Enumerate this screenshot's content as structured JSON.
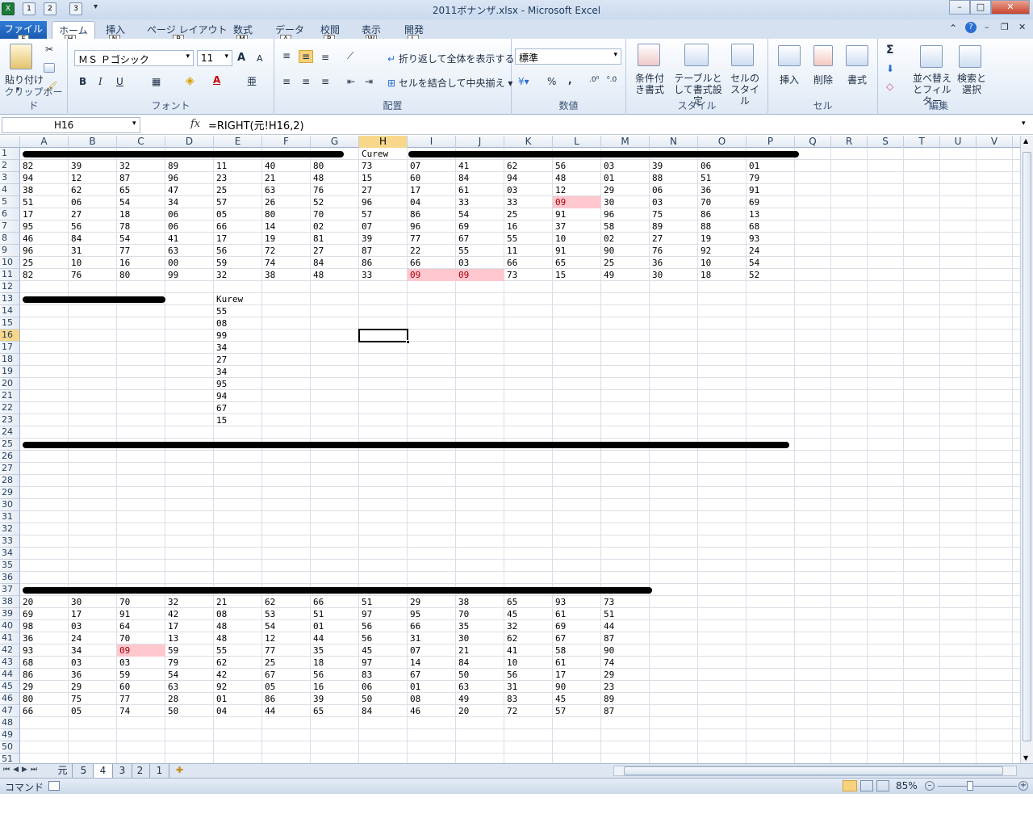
{
  "window": {
    "title": "2011ボナンザ.xlsx - Microsoft Excel"
  },
  "qat": {
    "keys": [
      "1",
      "2",
      "3"
    ]
  },
  "tabs": [
    {
      "label": "ファイル",
      "key": "F"
    },
    {
      "label": "ホーム",
      "key": "H"
    },
    {
      "label": "挿入",
      "key": "N"
    },
    {
      "label": "ページ レイアウト",
      "key": "P"
    },
    {
      "label": "数式",
      "key": "M"
    },
    {
      "label": "データ",
      "key": "A"
    },
    {
      "label": "校閲",
      "key": "R"
    },
    {
      "label": "表示",
      "key": "W"
    },
    {
      "label": "開発",
      "key": "L"
    }
  ],
  "ribbon": {
    "clipboard": {
      "paste": "貼り付け",
      "group": "クリップボード"
    },
    "font": {
      "name": "ＭＳ Ｐゴシック",
      "size": "11",
      "group": "フォント",
      "bold": "B",
      "italic": "I",
      "underline": "U",
      "grow": "A",
      "shrink": "A"
    },
    "alignment": {
      "wrap": "折り返して全体を表示する",
      "merge": "セルを結合して中央揃え",
      "group": "配置"
    },
    "number": {
      "format": "標準",
      "percent": "%",
      "comma": ",",
      "group": "数値"
    },
    "styles": {
      "conditional": "条件付き書式",
      "table": "テーブルとして書式設定",
      "cell_styles": "セルのスタイル",
      "group": "スタイル"
    },
    "cells": {
      "insert": "挿入",
      "delete": "削除",
      "format": "書式",
      "group": "セル"
    },
    "editing": {
      "sort": "並べ替えとフィルター",
      "find": "検索と選択",
      "group": "編集",
      "sum": "Σ"
    }
  },
  "formula_bar": {
    "name_box": "H16",
    "fx": "fx",
    "formula": "=RIGHT(元!H16,2)"
  },
  "columns": [
    "A",
    "B",
    "C",
    "D",
    "E",
    "F",
    "G",
    "H",
    "I",
    "J",
    "K",
    "L",
    "M",
    "N",
    "O",
    "P",
    "Q",
    "R",
    "S",
    "T",
    "U",
    "V"
  ],
  "selected_cell": {
    "col": "H",
    "row": 16
  },
  "sheet": {
    "row1_labels": {
      "H": "Curew"
    },
    "block1": [
      [
        "82",
        "39",
        "32",
        "89",
        "11",
        "40",
        "80",
        "73",
        "07",
        "41",
        "62",
        "56",
        "03",
        "39",
        "06",
        "01"
      ],
      [
        "94",
        "12",
        "87",
        "96",
        "23",
        "21",
        "48",
        "15",
        "60",
        "84",
        "94",
        "48",
        "01",
        "88",
        "51",
        "79"
      ],
      [
        "38",
        "62",
        "65",
        "47",
        "25",
        "63",
        "76",
        "27",
        "17",
        "61",
        "03",
        "12",
        "29",
        "06",
        "36",
        "91"
      ],
      [
        "51",
        "06",
        "54",
        "34",
        "57",
        "26",
        "52",
        "96",
        "04",
        "33",
        "33",
        "09",
        "30",
        "03",
        "70",
        "69"
      ],
      [
        "17",
        "27",
        "18",
        "06",
        "05",
        "80",
        "70",
        "57",
        "86",
        "54",
        "25",
        "91",
        "96",
        "75",
        "86",
        "13"
      ],
      [
        "95",
        "56",
        "78",
        "06",
        "66",
        "14",
        "02",
        "07",
        "96",
        "69",
        "16",
        "37",
        "58",
        "89",
        "88",
        "68"
      ],
      [
        "46",
        "84",
        "54",
        "41",
        "17",
        "19",
        "81",
        "39",
        "77",
        "67",
        "55",
        "10",
        "02",
        "27",
        "19",
        "93"
      ],
      [
        "96",
        "31",
        "77",
        "63",
        "56",
        "72",
        "27",
        "87",
        "22",
        "55",
        "11",
        "91",
        "90",
        "76",
        "92",
        "24"
      ],
      [
        "25",
        "10",
        "16",
        "00",
        "59",
        "74",
        "84",
        "86",
        "66",
        "03",
        "66",
        "65",
        "25",
        "36",
        "10",
        "54"
      ],
      [
        "82",
        "76",
        "80",
        "99",
        "32",
        "38",
        "48",
        "33",
        "09",
        "09",
        "73",
        "15",
        "49",
        "30",
        "18",
        "52"
      ]
    ],
    "block2_label": "Kurew",
    "block2": [
      "55",
      "08",
      "99",
      "34",
      "27",
      "34",
      "95",
      "94",
      "67",
      "15"
    ],
    "block3": [
      [
        "20",
        "30",
        "70",
        "32",
        "21",
        "62",
        "66",
        "51",
        "29",
        "38",
        "65",
        "93",
        "73"
      ],
      [
        "69",
        "17",
        "91",
        "42",
        "08",
        "53",
        "51",
        "97",
        "95",
        "70",
        "45",
        "61",
        "51"
      ],
      [
        "98",
        "03",
        "64",
        "17",
        "48",
        "54",
        "01",
        "56",
        "66",
        "35",
        "32",
        "69",
        "44"
      ],
      [
        "36",
        "24",
        "70",
        "13",
        "48",
        "12",
        "44",
        "56",
        "31",
        "30",
        "62",
        "67",
        "87"
      ],
      [
        "93",
        "34",
        "09",
        "59",
        "55",
        "77",
        "35",
        "45",
        "07",
        "21",
        "41",
        "58",
        "90"
      ],
      [
        "68",
        "03",
        "03",
        "79",
        "62",
        "25",
        "18",
        "97",
        "14",
        "84",
        "10",
        "61",
        "74"
      ],
      [
        "86",
        "36",
        "59",
        "54",
        "42",
        "67",
        "56",
        "83",
        "67",
        "50",
        "56",
        "17",
        "29"
      ],
      [
        "29",
        "29",
        "60",
        "63",
        "92",
        "05",
        "16",
        "06",
        "01",
        "63",
        "31",
        "90",
        "23"
      ],
      [
        "80",
        "75",
        "77",
        "28",
        "01",
        "86",
        "39",
        "50",
        "08",
        "49",
        "83",
        "45",
        "89"
      ],
      [
        "66",
        "05",
        "74",
        "50",
        "04",
        "44",
        "65",
        "84",
        "46",
        "20",
        "72",
        "57",
        "87"
      ]
    ]
  },
  "sheet_tabs": [
    "元",
    "5",
    "4",
    "3",
    "2",
    "1"
  ],
  "active_sheet": "4",
  "status": {
    "mode": "コマンド",
    "zoom": "85%"
  }
}
